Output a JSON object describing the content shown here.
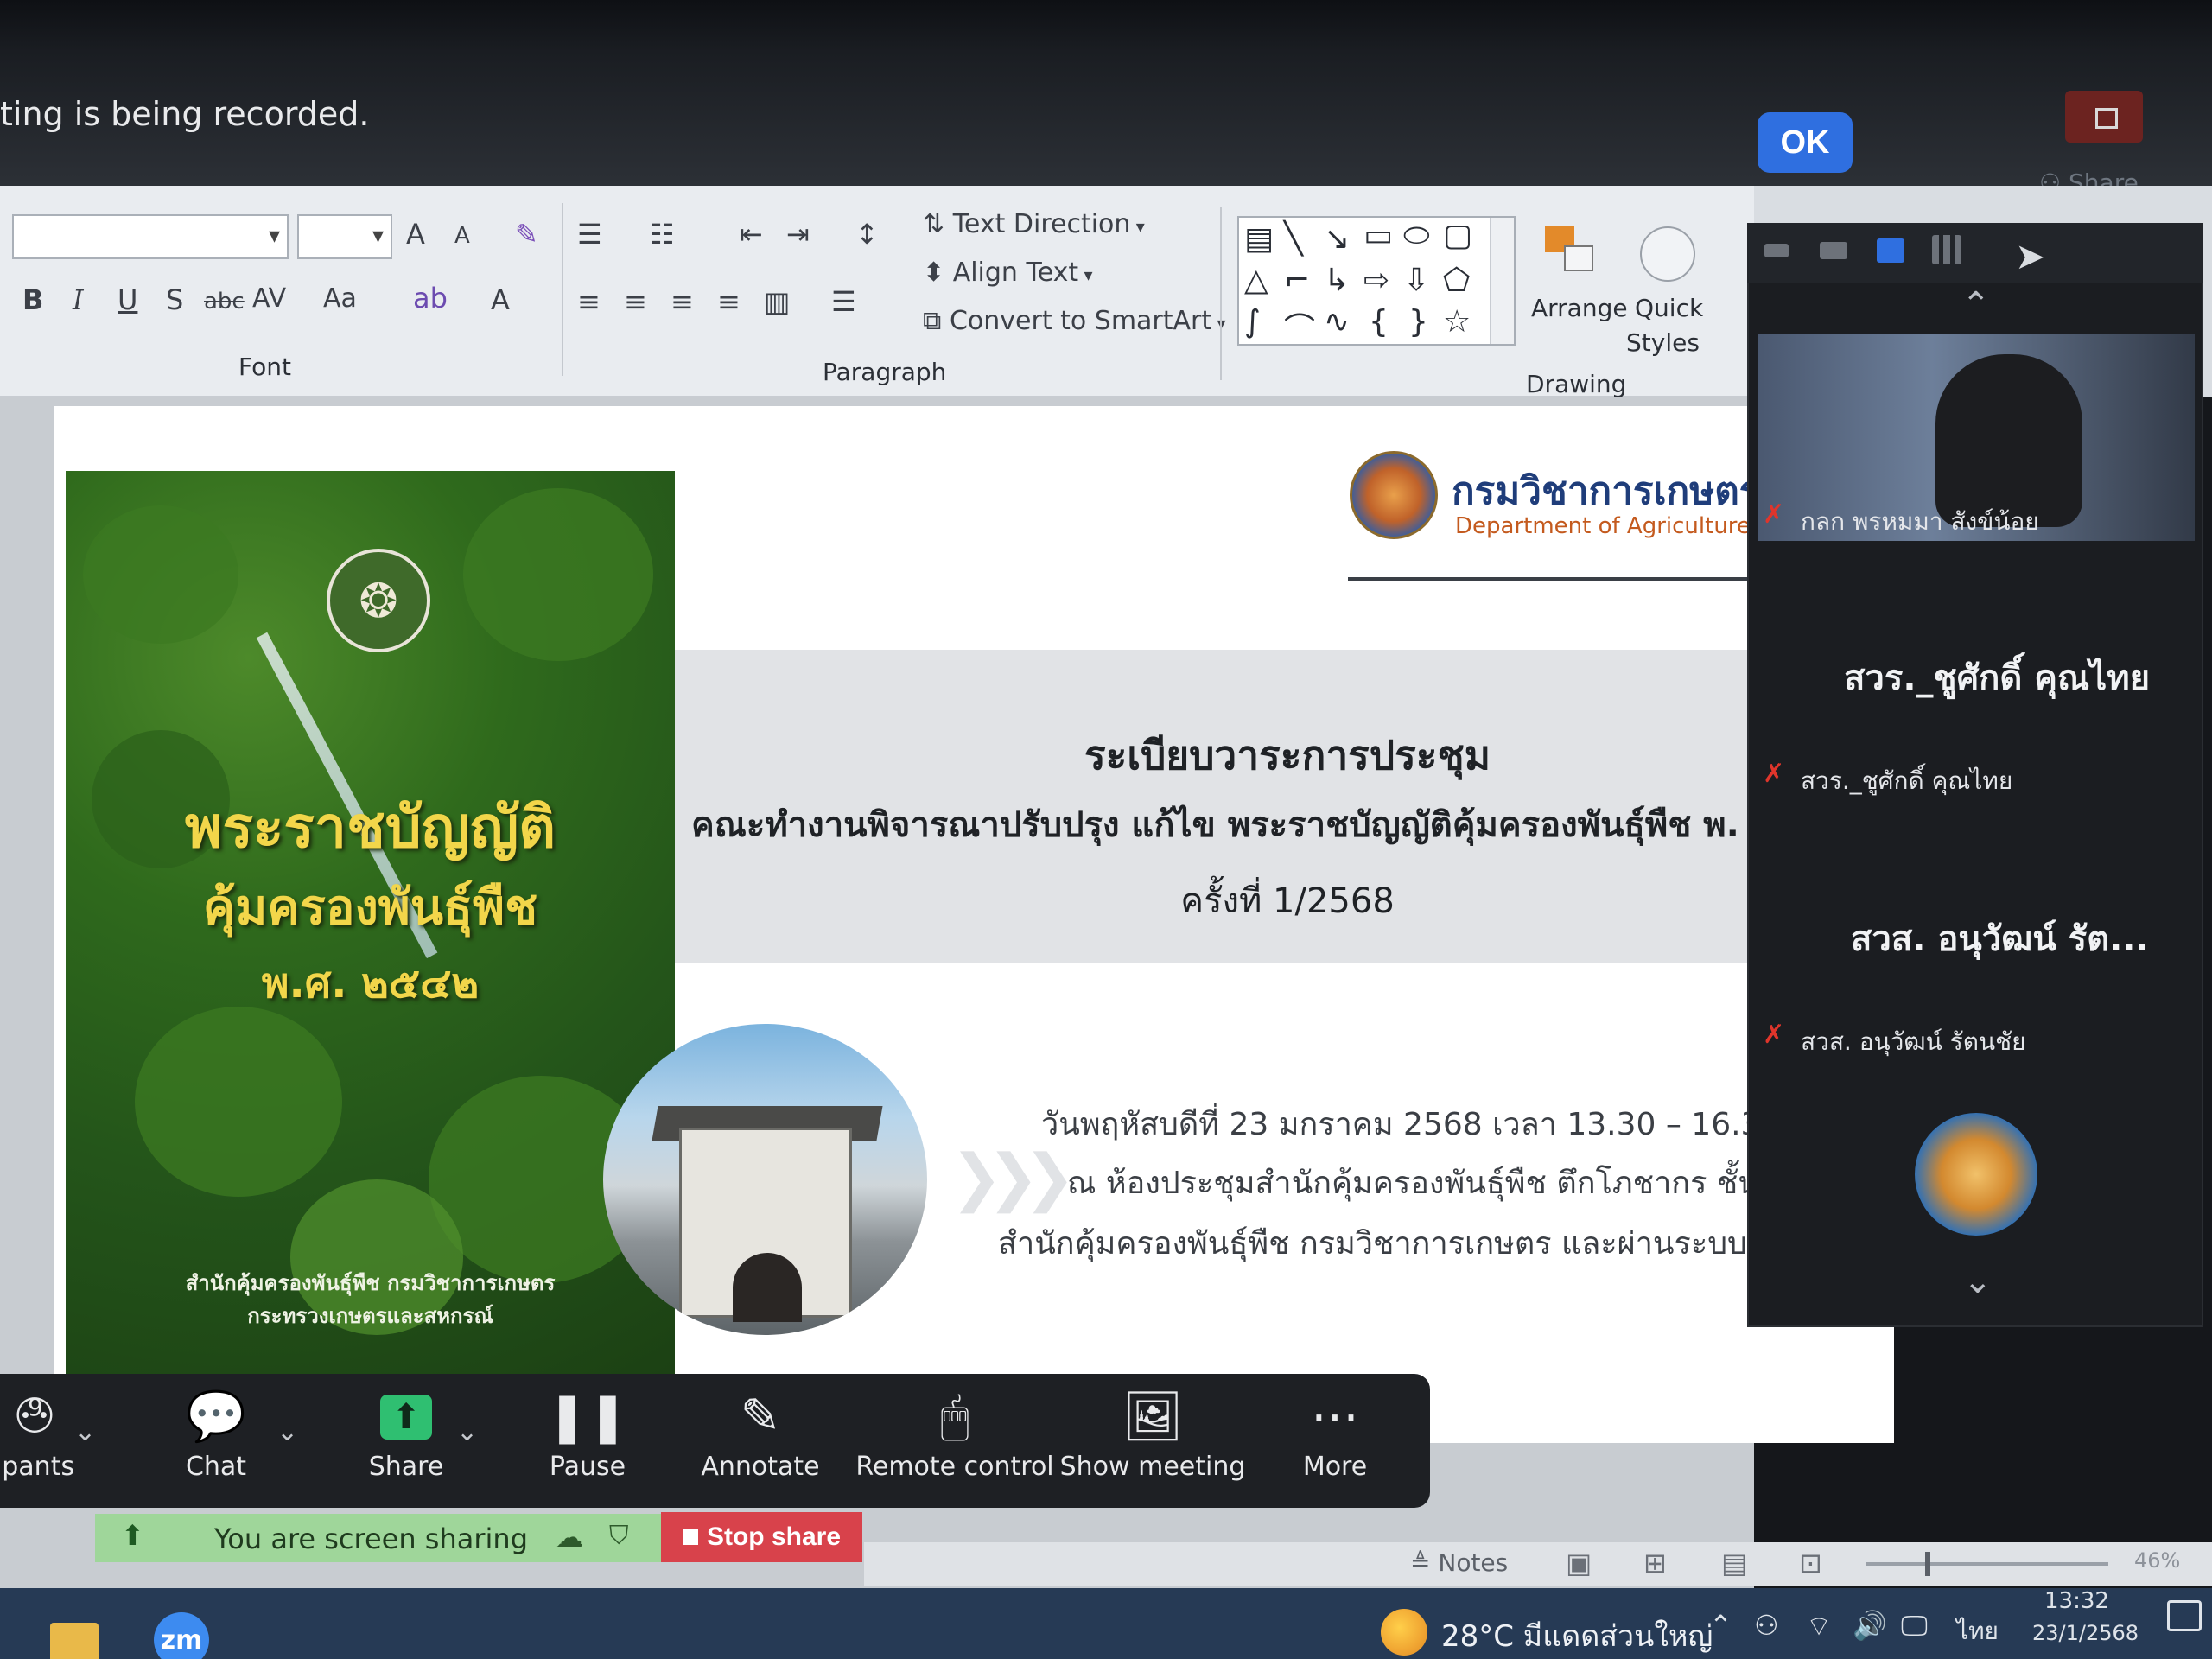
{
  "banner": {
    "recording_text": "ting is being recorded.",
    "ok_label": "OK",
    "share_label": "Share"
  },
  "ribbon": {
    "font_group_label": "Font",
    "paragraph_group_label": "Paragraph",
    "drawing_group_label": "Drawing",
    "text_direction": "Text Direction",
    "align_text": "Align Text",
    "convert_smartart": "Convert to SmartArt",
    "arrange": "Arrange",
    "quick": "Quick",
    "styles": "Styles",
    "font_buttons": {
      "bold": "B",
      "italic": "I",
      "underline": "U",
      "shadow": "S",
      "strike": "abc",
      "spacing": "AV",
      "case": "Aa",
      "grow": "A",
      "shrink": "A",
      "color": "A"
    }
  },
  "slide": {
    "book": {
      "title_1": "พระราชบัญญัติ",
      "title_2": "คุ้มครองพันธุ์พืช",
      "title_3": "พ.ศ. ๒๕๔๒",
      "publisher_1": "สำนักคุ้มครองพันธุ์พืช กรมวิชาการเกษตร",
      "publisher_2": "กระทรวงเกษตรและสหกรณ์"
    },
    "dept_th": "กรมวิชาการเกษตร",
    "dept_en": "Department of Agriculture",
    "agenda_title": "ระเบียบวาระการประชุม",
    "agenda_subtitle": "คณะทำงานพิจารณาปรับปรุง แก้ไข พระราชบัญญัติคุ้มครองพันธุ์พืช พ.",
    "agenda_number": "ครั้งที่ 1/2568",
    "meeting_line_1": "วันพฤหัสบดีที่ 23 มกราคม 2568 เวลา 13.30 – 16.3",
    "meeting_line_2": "ณ ห้องประชุมสำนักคุ้มครองพันธุ์พืช ตึกโภชากร ชั้น",
    "meeting_line_3": "สำนักคุ้มครองพันธุ์พืช กรมวิชาการเกษตร และผ่านระบบ"
  },
  "video_panel": {
    "participants": [
      {
        "tile_name": "",
        "label": "กลก พรหมมา สังข์น้อย"
      },
      {
        "tile_name": "สวร._ชูศักดิ์ คุณไทย",
        "label": "สวร._ชูศักดิ์ คุณไทย"
      },
      {
        "tile_name": "สวส. อนุวัฒน์ รัต...",
        "label": "สวส. อนุวัฒน์ รัตนชัย"
      }
    ]
  },
  "toolbar": {
    "participants_count": "9",
    "participants_label": "ipants",
    "chat_label": "Chat",
    "share_label": "Share",
    "pause_label": "Pause",
    "annotate_label": "Annotate",
    "remote_control_label": "Remote control",
    "show_meeting_label": "Show meeting",
    "more_label": "More",
    "sharing_status": "You are screen sharing",
    "stop_share_label": "Stop share"
  },
  "ppt_status": {
    "notes_label": "Notes",
    "zoom_level": "46%"
  },
  "taskbar": {
    "zoom_app": "zm",
    "weather": "28°C มีแดดส่วนใหญ่",
    "language": "ไทย",
    "time": "13:32",
    "date": "23/1/2568"
  },
  "colors": {
    "zoom_blue": "#2f6fe0",
    "share_green": "#2fbf71",
    "stop_red": "#d8424b",
    "doa_blue": "#1f3d7a",
    "doa_orange": "#c45a1e"
  }
}
